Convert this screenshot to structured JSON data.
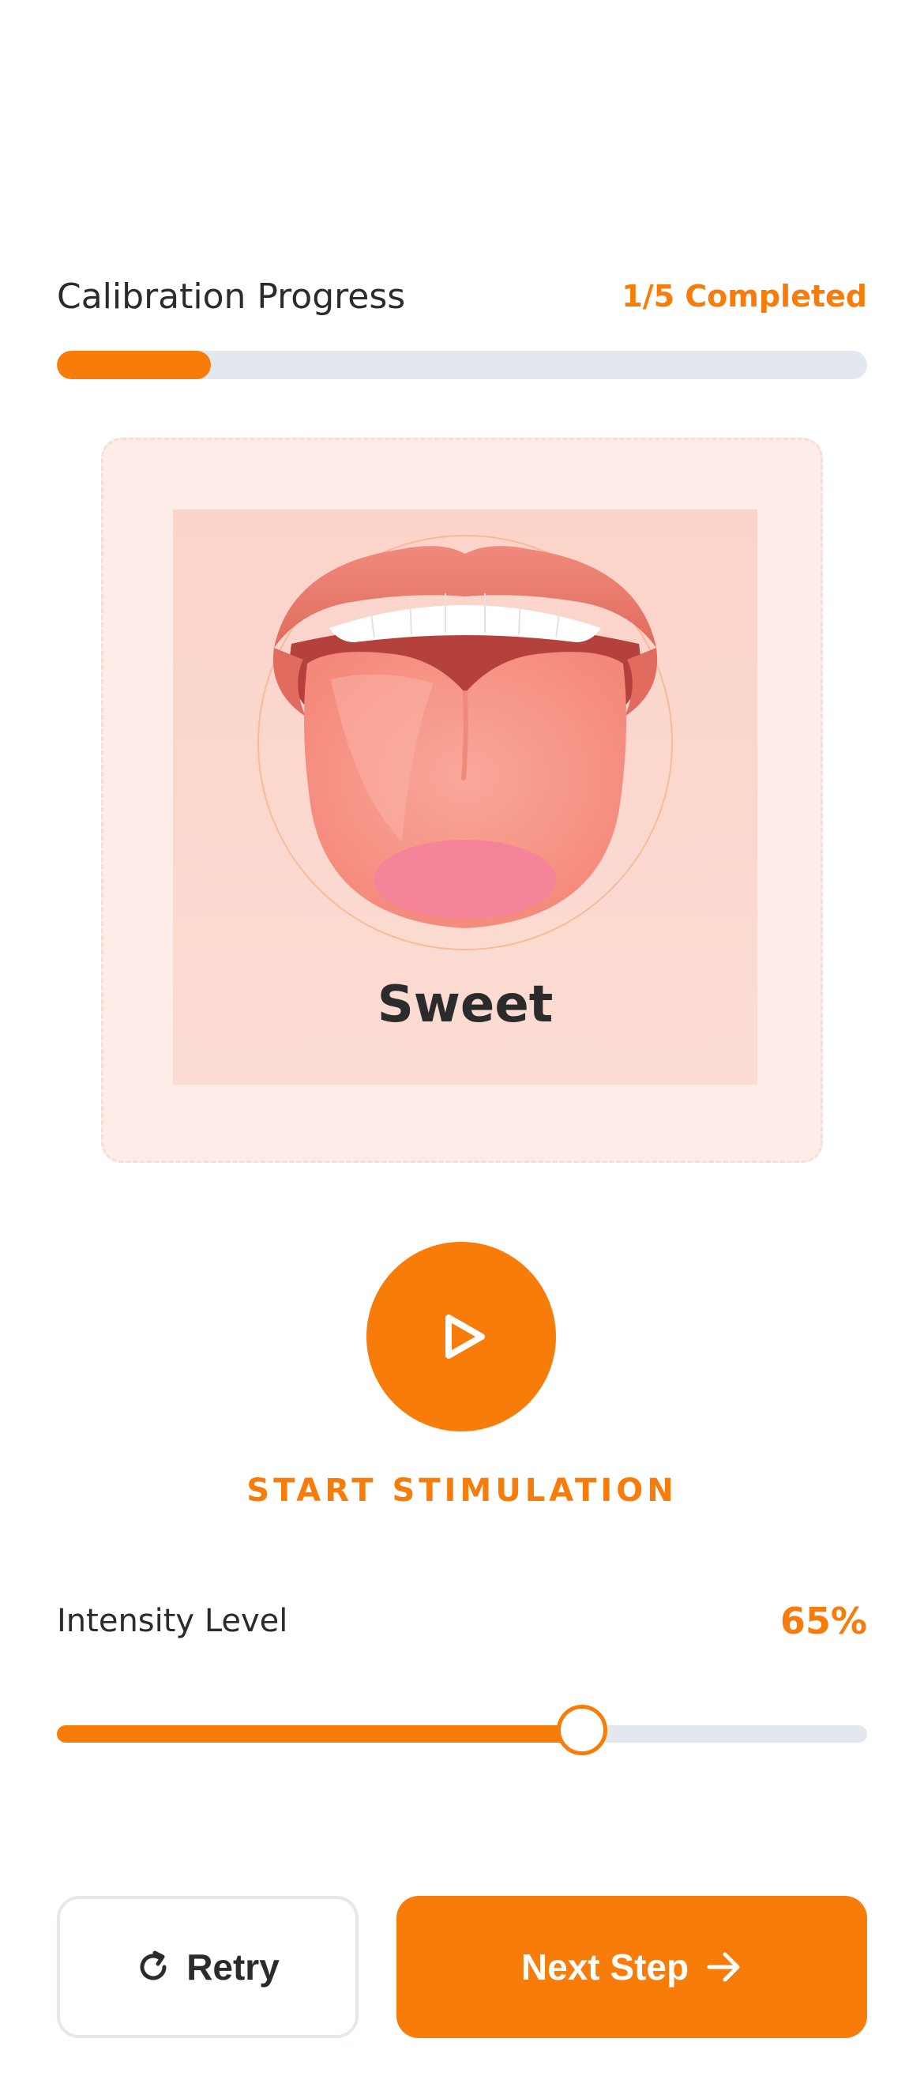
{
  "calibration": {
    "title": "Calibration Progress",
    "status": "1/5 Completed",
    "progress_fraction": 0.19
  },
  "illustration": {
    "taste_label": "Sweet",
    "subject": "tongue-illustration"
  },
  "stimulation": {
    "button_icon": "play-icon",
    "label": "START STIMULATION"
  },
  "intensity": {
    "title": "Intensity Level",
    "value_text": "65%",
    "value": 65
  },
  "actions": {
    "retry_label": "Retry",
    "retry_icon": "refresh-icon",
    "next_label": "Next Step",
    "next_icon": "arrow-right-icon"
  },
  "colors": {
    "accent": "#f87c0a",
    "track": "#e3e8ef",
    "text": "#2b2b2b",
    "card_bg": "#fdece8"
  }
}
